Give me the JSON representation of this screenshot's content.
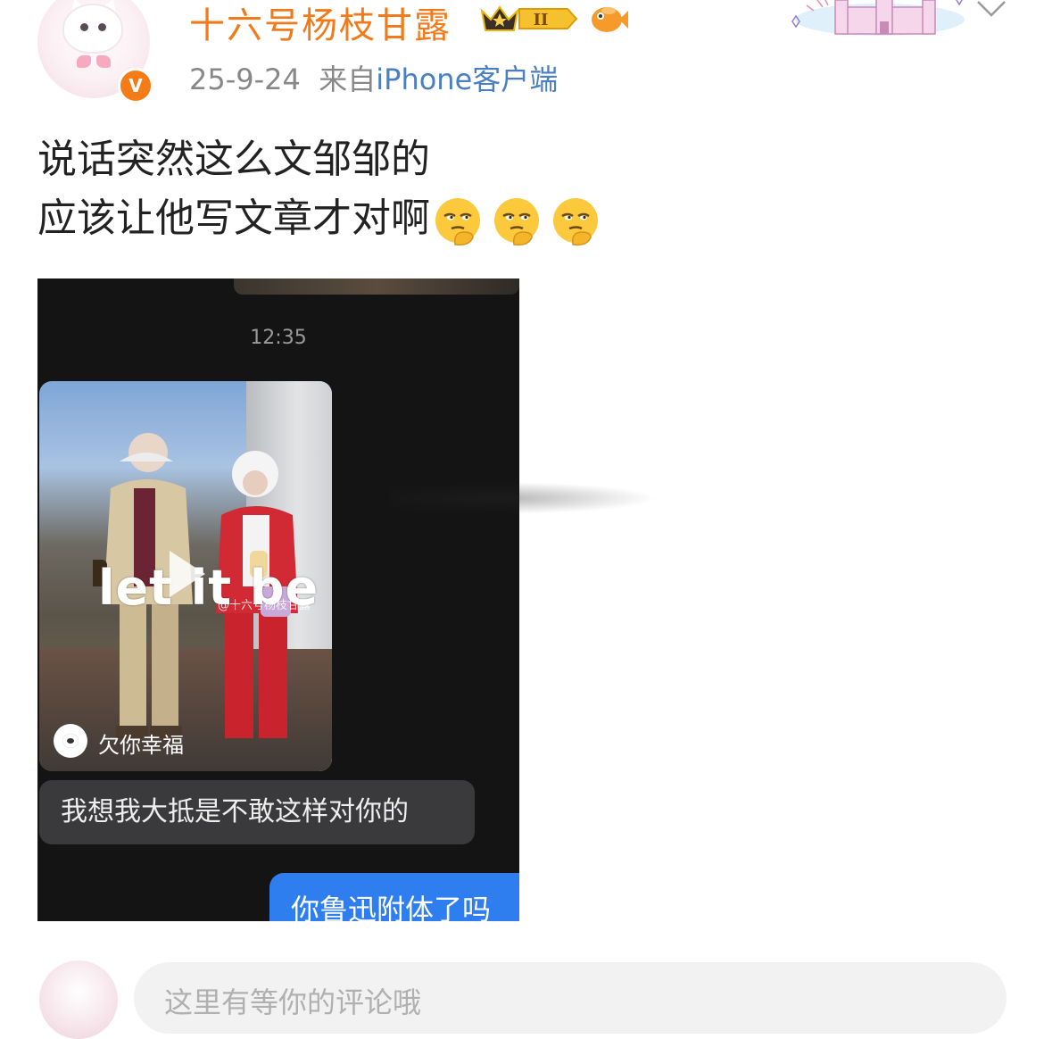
{
  "post": {
    "author": "十六号杨枝甘露",
    "verified_mark": "V",
    "date": "25-9-24",
    "source_prefix": "来自",
    "source_device": "iPhone客户端",
    "text_line1": "说话突然这么文邹邹的",
    "text_line2": "应该让他写文章才对啊",
    "emoji_icons": [
      "thinking-face-icon",
      "thinking-face-icon",
      "thinking-face-icon"
    ],
    "member_badge_level": "II"
  },
  "screenshot": {
    "time": "12:35",
    "video_overlay_text": "let it be",
    "video_watermark": "@十六号杨枝甘露",
    "channel_name": "欠你幸福",
    "message_in": "我想我大抵是不敢这样对你的",
    "message_out": "你鲁迅附体了吗"
  },
  "comment": {
    "placeholder": "这里有等你的评论哦"
  },
  "colors": {
    "username": "#f27a1a",
    "source": "#4a7fc1",
    "bubble_out": "#2f7ef0",
    "chat_bg": "#141414"
  }
}
